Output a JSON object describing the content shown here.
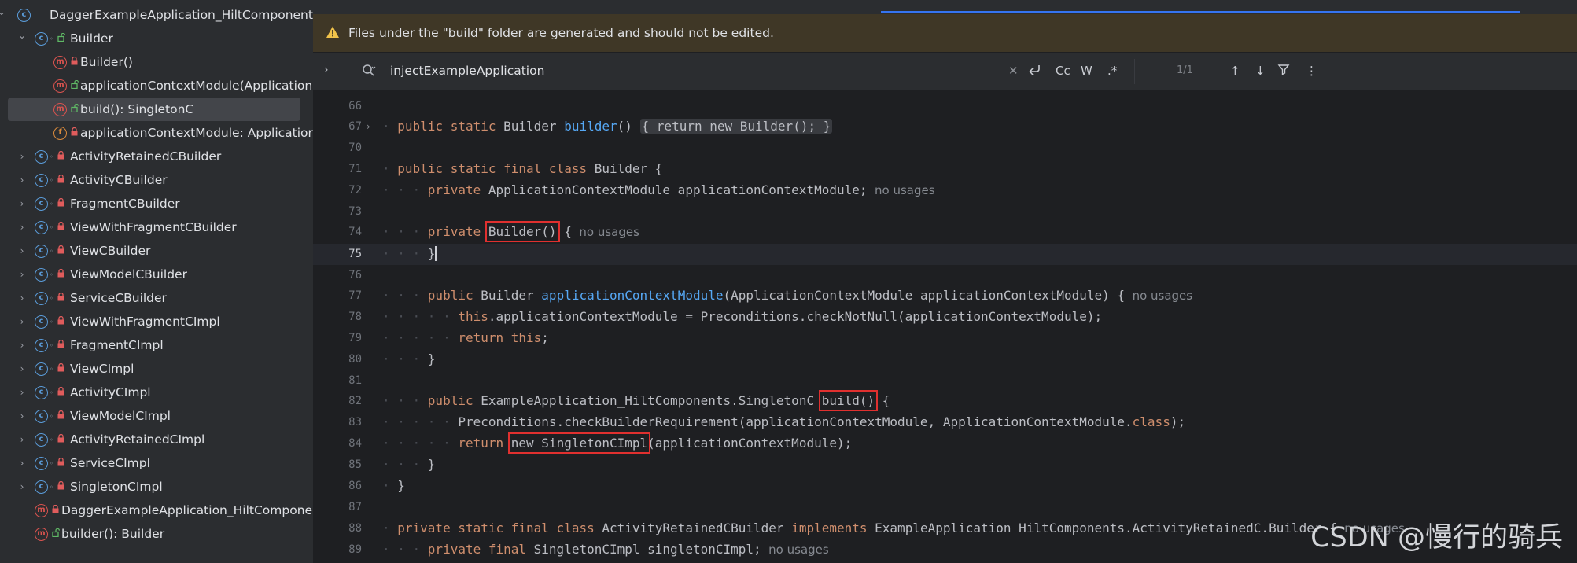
{
  "structure": {
    "items": [
      {
        "label": "DaggerExampleApplication_HiltComponents_",
        "chevron": "down",
        "icon": "class",
        "vis": "static"
      },
      {
        "label": "Builder",
        "chevron": "down",
        "icon": "class",
        "vis": "open"
      },
      {
        "label": "Builder()",
        "chevron": "none",
        "icon": "method",
        "vis": "lock"
      },
      {
        "label": "applicationContextModule(Application",
        "chevron": "none",
        "icon": "method",
        "vis": "open"
      },
      {
        "label": "build(): SingletonC",
        "chevron": "none",
        "icon": "method",
        "vis": "open",
        "selected": true
      },
      {
        "label": "applicationContextModule: Applicatior",
        "chevron": "none",
        "icon": "field",
        "vis": "lock"
      },
      {
        "label": "ActivityRetainedCBuilder",
        "chevron": "right",
        "icon": "class",
        "vis": "lock"
      },
      {
        "label": "ActivityCBuilder",
        "chevron": "right",
        "icon": "class",
        "vis": "lock"
      },
      {
        "label": "FragmentCBuilder",
        "chevron": "right",
        "icon": "class",
        "vis": "lock"
      },
      {
        "label": "ViewWithFragmentCBuilder",
        "chevron": "right",
        "icon": "class",
        "vis": "lock"
      },
      {
        "label": "ViewCBuilder",
        "chevron": "right",
        "icon": "class",
        "vis": "lock"
      },
      {
        "label": "ViewModelCBuilder",
        "chevron": "right",
        "icon": "class",
        "vis": "lock"
      },
      {
        "label": "ServiceCBuilder",
        "chevron": "right",
        "icon": "class",
        "vis": "lock"
      },
      {
        "label": "ViewWithFragmentCImpl",
        "chevron": "right",
        "icon": "class",
        "vis": "lock"
      },
      {
        "label": "FragmentCImpl",
        "chevron": "right",
        "icon": "class",
        "vis": "lock"
      },
      {
        "label": "ViewCImpl",
        "chevron": "right",
        "icon": "class",
        "vis": "lock"
      },
      {
        "label": "ActivityCImpl",
        "chevron": "right",
        "icon": "class",
        "vis": "lock"
      },
      {
        "label": "ViewModelCImpl",
        "chevron": "right",
        "icon": "class",
        "vis": "lock"
      },
      {
        "label": "ActivityRetainedCImpl",
        "chevron": "right",
        "icon": "class",
        "vis": "lock"
      },
      {
        "label": "ServiceCImpl",
        "chevron": "right",
        "icon": "class",
        "vis": "lock"
      },
      {
        "label": "SingletonCImpl",
        "chevron": "right",
        "icon": "class",
        "vis": "lock"
      },
      {
        "label": "DaggerExampleApplication_HiltComponer",
        "chevron": "none",
        "icon": "method",
        "vis": "lock"
      },
      {
        "label": "builder(): Builder",
        "chevron": "none",
        "icon": "method",
        "vis": "open"
      }
    ]
  },
  "banner": {
    "text": "Files under the \"build\" folder are generated and should not be edited."
  },
  "search": {
    "query": "injectExampleApplication",
    "match_case": "Cc",
    "whole_word": "W",
    "regex": ".*",
    "count": "1/1"
  },
  "code": {
    "lines": [
      {
        "n": "66",
        "parts": []
      },
      {
        "n": "67",
        "fold": true,
        "parts": [
          [
            "ws",
            "· "
          ],
          [
            "kw",
            "public static "
          ],
          [
            "ty",
            "Builder "
          ],
          [
            "fn",
            "builder"
          ],
          [
            "ty",
            "() "
          ],
          [
            "fold",
            "{ return new Builder(); }"
          ]
        ]
      },
      {
        "n": "70",
        "parts": []
      },
      {
        "n": "71",
        "parts": [
          [
            "ws",
            "· "
          ],
          [
            "kw",
            "public static final class "
          ],
          [
            "ty",
            "Builder {"
          ]
        ]
      },
      {
        "n": "72",
        "parts": [
          [
            "ws",
            "· · · "
          ],
          [
            "kw",
            "private "
          ],
          [
            "ty",
            "ApplicationContextModule applicationContextModule;"
          ],
          [
            "hint",
            "  no usages"
          ]
        ]
      },
      {
        "n": "73",
        "parts": []
      },
      {
        "n": "74",
        "parts": [
          [
            "ws",
            "· · · "
          ],
          [
            "kw",
            "private "
          ],
          [
            "box",
            "Builder()"
          ],
          [
            "ty",
            " {"
          ],
          [
            "hint",
            "  no usages"
          ]
        ]
      },
      {
        "n": "75",
        "current": true,
        "parts": [
          [
            "ws",
            "· · · "
          ],
          [
            "ty",
            "}"
          ],
          [
            "caret",
            ""
          ]
        ]
      },
      {
        "n": "76",
        "parts": []
      },
      {
        "n": "77",
        "parts": [
          [
            "ws",
            "· · · "
          ],
          [
            "kw",
            "public "
          ],
          [
            "ty",
            "Builder "
          ],
          [
            "fn",
            "applicationContextModule"
          ],
          [
            "ty",
            "(ApplicationContextModule applicationContextModule) {"
          ],
          [
            "hint",
            "  no usages"
          ]
        ]
      },
      {
        "n": "78",
        "parts": [
          [
            "ws",
            "· · · · · "
          ],
          [
            "kw",
            "this"
          ],
          [
            "ty",
            ".applicationContextModule = Preconditions."
          ],
          [
            "ty",
            "checkNotNull(applicationContextModule);"
          ]
        ]
      },
      {
        "n": "79",
        "parts": [
          [
            "ws",
            "· · · · · "
          ],
          [
            "kw",
            "return this"
          ],
          [
            "ty",
            ";"
          ]
        ]
      },
      {
        "n": "80",
        "parts": [
          [
            "ws",
            "· · · "
          ],
          [
            "ty",
            "}"
          ]
        ]
      },
      {
        "n": "81",
        "parts": []
      },
      {
        "n": "82",
        "parts": [
          [
            "ws",
            "· · · "
          ],
          [
            "kw",
            "public "
          ],
          [
            "ty",
            "ExampleApplication_HiltComponents.SingletonC "
          ],
          [
            "box",
            "build()"
          ],
          [
            "ty",
            " {"
          ]
        ]
      },
      {
        "n": "83",
        "parts": [
          [
            "ws",
            "· · · · · "
          ],
          [
            "ty",
            "Preconditions.checkBuilderRequirement(applicationContextModule, ApplicationContextModule."
          ],
          [
            "kw",
            "class"
          ],
          [
            "ty",
            ");"
          ]
        ]
      },
      {
        "n": "84",
        "parts": [
          [
            "ws",
            "· · · · · "
          ],
          [
            "kw",
            "return "
          ],
          [
            "box",
            "new SingletonCImpl"
          ],
          [
            "ty",
            "(applicationContextModule);"
          ]
        ]
      },
      {
        "n": "85",
        "parts": [
          [
            "ws",
            "· · · "
          ],
          [
            "ty",
            "}"
          ]
        ]
      },
      {
        "n": "86",
        "parts": [
          [
            "ws",
            "· "
          ],
          [
            "ty",
            "}"
          ]
        ]
      },
      {
        "n": "87",
        "parts": []
      },
      {
        "n": "88",
        "parts": [
          [
            "ws",
            "· "
          ],
          [
            "kw",
            "private static final class "
          ],
          [
            "ty",
            "ActivityRetainedCBuilder "
          ],
          [
            "kw",
            "implements "
          ],
          [
            "ty",
            "ExampleApplication_HiltComponents.ActivityRetainedC.Builder {"
          ],
          [
            "hint",
            "  no usages"
          ]
        ]
      },
      {
        "n": "89",
        "parts": [
          [
            "ws",
            "· · · "
          ],
          [
            "kw",
            "private final "
          ],
          [
            "ty",
            "SingletonCImpl singletonCImpl;"
          ],
          [
            "hint",
            "  no usages"
          ]
        ]
      }
    ]
  },
  "watermark": "CSDN @慢行的骑兵",
  "colors": {
    "accent": "#3574f0",
    "highlight_box": "#e0302f",
    "banner_bg": "#3f3726"
  }
}
